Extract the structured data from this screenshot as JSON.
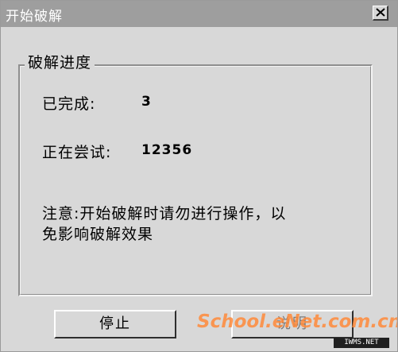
{
  "window": {
    "title": "开始破解",
    "close_icon": "close-icon"
  },
  "group": {
    "title": "破解进度",
    "completed_label": "已完成:",
    "completed_value": "3",
    "trying_label": "正在尝试:",
    "trying_value": "12356",
    "note_line1": "注意:开始破解时请勿进行操作，以",
    "note_line2": "免影响破解效果"
  },
  "buttons": {
    "stop_label": "停止",
    "help_label": "说明"
  },
  "watermark": {
    "text": "School.eNet.com.cn",
    "badge": "IWMS.NET"
  },
  "colors": {
    "dialog_bg": "#d8d8d8",
    "titlebar_bg": "#9e9e9e",
    "watermark": "#ff8a3a"
  }
}
